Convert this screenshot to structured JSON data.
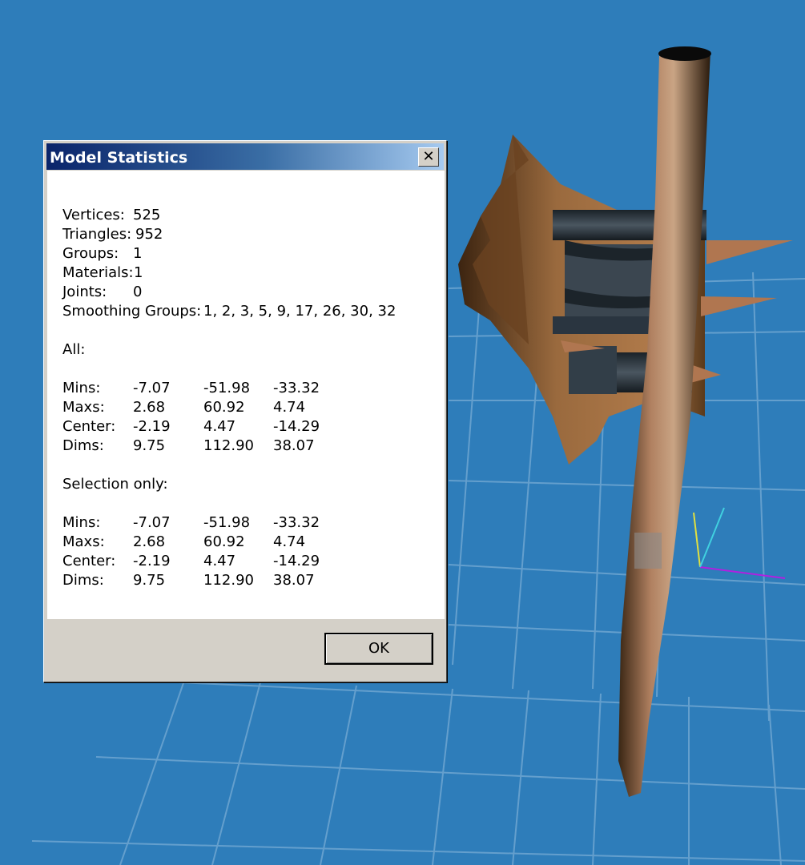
{
  "dialog": {
    "title": "Model Statistics",
    "close_label": "✕",
    "ok_label": "OK"
  },
  "stats": {
    "vertices": {
      "label": "Vertices:",
      "value": "525"
    },
    "triangles": {
      "label": "Triangles:",
      "value": "952"
    },
    "groups": {
      "label": "Groups:",
      "value": "1"
    },
    "materials": {
      "label": "Materials:",
      "value": "1"
    },
    "joints": {
      "label": "Joints:",
      "value": "0"
    },
    "smoothing": {
      "label": "Smoothing Groups:",
      "value": "1, 2, 3, 5, 9, 17, 26, 30, 32"
    }
  },
  "all": {
    "heading": "All:",
    "rows": [
      {
        "label": "Mins:",
        "x": "-7.07",
        "y": "-51.98",
        "z": "-33.32"
      },
      {
        "label": "Maxs:",
        "x": "2.68",
        "y": "60.92",
        "z": "4.74"
      },
      {
        "label": "Center:",
        "x": "-2.19",
        "y": "4.47",
        "z": "-14.29"
      },
      {
        "label": "Dims:",
        "x": "9.75",
        "y": "112.90",
        "z": "38.07"
      }
    ]
  },
  "selection": {
    "heading": "Selection only:",
    "rows": [
      {
        "label": "Mins:",
        "x": "-7.07",
        "y": "-51.98",
        "z": "-33.32"
      },
      {
        "label": "Maxs:",
        "x": "2.68",
        "y": "60.92",
        "z": "4.74"
      },
      {
        "label": "Center:",
        "x": "-2.19",
        "y": "4.47",
        "z": "-14.29"
      },
      {
        "label": "Dims:",
        "x": "9.75",
        "y": "112.90",
        "z": "38.07"
      }
    ]
  },
  "colors": {
    "viewport_bg": "#2e7dba",
    "grid": "#6aa3d0",
    "axis_x": "#b020e0",
    "axis_y": "#e0e040",
    "axis_z": "#40d0e0"
  }
}
